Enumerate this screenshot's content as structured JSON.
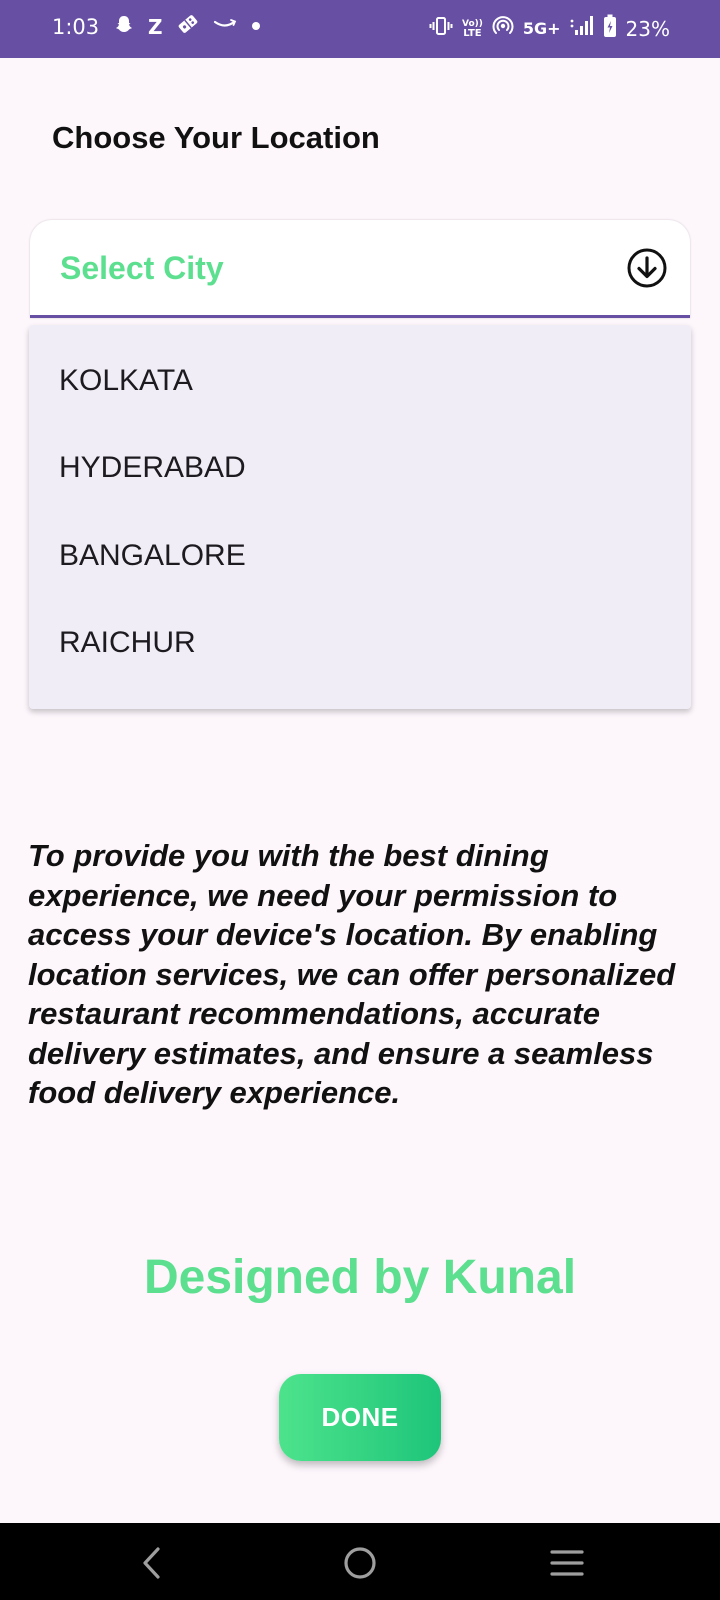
{
  "status_bar": {
    "time": "1:03",
    "left_icons": [
      "snapchat-icon",
      "zomato-icon",
      "domino-icon",
      "amazon-icon",
      "dot-icon"
    ],
    "right_icons": [
      "vibrate-icon",
      "volte-icon",
      "hotspot-icon",
      "signal-icon",
      "battery-icon"
    ],
    "volte_top": "Vo))",
    "volte_bottom": "LTE",
    "network": "5G+",
    "battery": "23%"
  },
  "page": {
    "title": "Choose Your Location"
  },
  "city_select": {
    "label": "Select City",
    "arrow_icon": "arrow-down-circle-icon",
    "options": [
      "KOLKATA",
      "HYDERABAD",
      "BANGALORE",
      "RAICHUR"
    ]
  },
  "description": "To provide you with the best dining experience, we need your permission to access your device's location. By enabling location services, we can offer personalized restaurant recommendations, accurate delivery estimates, and ensure a seamless food delivery experience.",
  "credit": "Designed by Kunal",
  "done_button": {
    "label": "DONE"
  },
  "nav_bar": {
    "icons": [
      "back-icon",
      "home-icon",
      "recents-icon"
    ]
  },
  "colors": {
    "status_bar": "#6750a4",
    "accent_green": "#5cdf8f",
    "button_gradient_start": "#4de38c",
    "button_gradient_end": "#1ec57a",
    "background": "#fdf7fc",
    "menu_background": "#f1edf6"
  }
}
